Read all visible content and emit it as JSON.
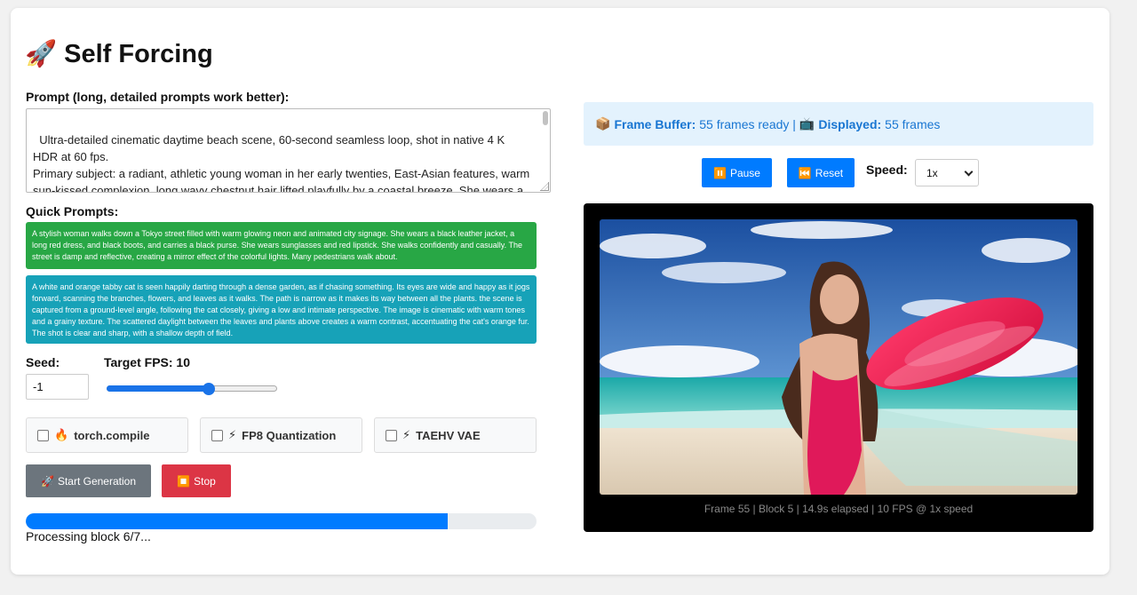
{
  "app": {
    "icon": "rocket-icon",
    "title": "Self Forcing"
  },
  "prompt": {
    "label": "Prompt (long, detailed prompts work better):",
    "value": "Ultra-detailed cinematic daytime beach scene, 60-second seamless loop, shot in native 4 K HDR at 60 fps.\nPrimary subject: a radiant, athletic young woman in her early twenties, East-Asian features, warm sun-kissed complexion, long wavy chestnut hair lifted playfully by a coastal breeze. She wears a vivid scarlet one-piece swimsuit with subtle retro lines that accentuate her poised"
  },
  "quick_prompts": {
    "label": "Quick Prompts:",
    "items": [
      {
        "text": "A stylish woman walks down a Tokyo street filled with warm glowing neon and animated city signage. She wears a black leather jacket, a long red dress, and black boots, and carries a black purse. She wears sunglasses and red lipstick. She walks confidently and casually. The street is damp and reflective, creating a mirror effect of the colorful lights. Many pedestrians walk about.",
        "color": "#28a745"
      },
      {
        "text": "A white and orange tabby cat is seen happily darting through a dense garden, as if chasing something. Its eyes are wide and happy as it jogs forward, scanning the branches, flowers, and leaves as it walks. The path is narrow as it makes its way between all the plants. the scene is captured from a ground-level angle, following the cat closely, giving a low and intimate perspective. The image is cinematic with warm tones and a grainy texture. The scattered daylight between the leaves and plants above creates a warm contrast, accentuating the cat's orange fur. The shot is clear and sharp, with a shallow depth of field.",
        "color": "#17a2b8"
      }
    ]
  },
  "seed": {
    "label": "Seed:",
    "value": "-1"
  },
  "fps": {
    "label": "Target FPS: 10",
    "value": 10,
    "min": 1,
    "max": 16
  },
  "options": [
    {
      "icon": "fire-icon",
      "emoji": "🔥",
      "label": "torch.compile",
      "checked": false
    },
    {
      "icon": "lightning-icon",
      "emoji": "⚡",
      "label": "FP8 Quantization",
      "checked": false
    },
    {
      "icon": "lightning-icon",
      "emoji": "⚡",
      "label": "TAEHV VAE",
      "checked": false
    }
  ],
  "actions": {
    "start_icon": "🚀",
    "start_label": "Start Generation",
    "stop_icon": "⏹️",
    "stop_label": "Stop"
  },
  "progress": {
    "fraction": 0.826,
    "status": "Processing block 6/7..."
  },
  "buffer": {
    "buffer_icon": "📦",
    "buffer_label": "Frame Buffer:",
    "buffer_value": "55 frames ready |",
    "display_icon": "📺",
    "display_label": "Displayed:",
    "display_value": "55 frames"
  },
  "playback": {
    "pause_icon": "⏸️",
    "pause_label": "Pause",
    "reset_icon": "⏮️",
    "reset_label": "Reset",
    "speed_label": "Speed:",
    "speed_value": "1x"
  },
  "video": {
    "caption": "Frame 55 | Block 5 | 14.9s elapsed | 10 FPS @ 1x speed"
  },
  "colors": {
    "primary": "#007bff",
    "danger": "#dc3545",
    "secondary": "#6c757d",
    "info_bg": "#e3f2fd",
    "info_text": "#1976d2"
  }
}
